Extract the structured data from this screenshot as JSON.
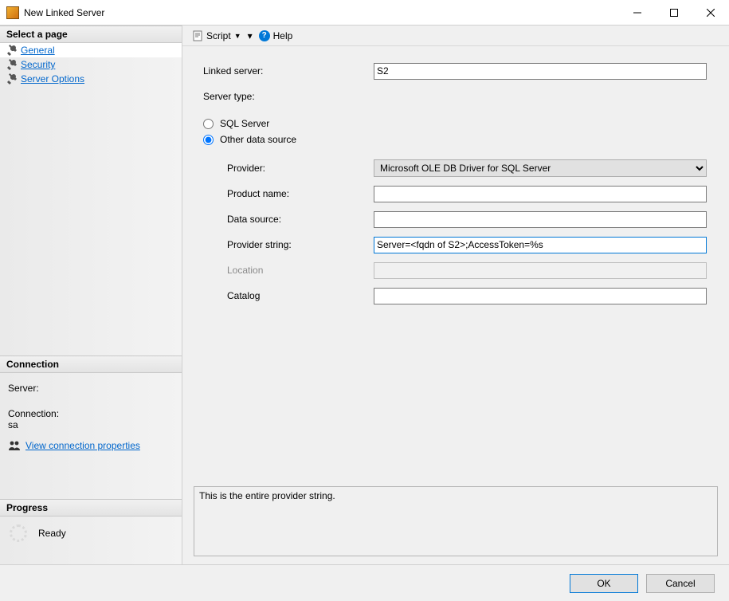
{
  "window": {
    "title": "New Linked Server"
  },
  "sidebar": {
    "select_page": "Select a page",
    "pages": {
      "general": "General",
      "security": "Security",
      "server_options": "Server Options"
    },
    "connection_header": "Connection",
    "server_label": "Server:",
    "server_value": "",
    "connection_label": "Connection:",
    "connection_value": "sa",
    "view_props": "View connection properties",
    "progress_header": "Progress",
    "progress_status": "Ready"
  },
  "toolbar": {
    "script": "Script",
    "help": "Help"
  },
  "form": {
    "linked_server_label": "Linked server:",
    "linked_server_value": "S2",
    "server_type_label": "Server type:",
    "radio_sql": "SQL Server",
    "radio_other": "Other data source",
    "provider_label": "Provider:",
    "provider_value": "Microsoft OLE DB Driver for SQL Server",
    "product_label": "Product name:",
    "product_value": "",
    "datasource_label": "Data source:",
    "datasource_value": "",
    "provstr_label": "Provider string:",
    "provstr_value": "Server=<fqdn of S2>;AccessToken=%s",
    "location_label": "Location",
    "location_value": "",
    "catalog_label": "Catalog",
    "catalog_value": "",
    "hint": "This is the entire provider string."
  },
  "footer": {
    "ok": "OK",
    "cancel": "Cancel"
  }
}
